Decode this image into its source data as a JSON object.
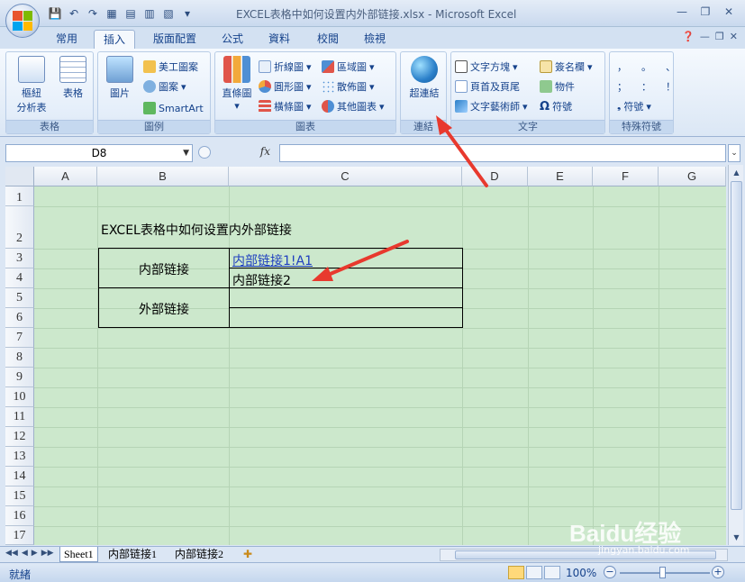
{
  "window": {
    "title": "EXCEL表格中如何设置内外部链接.xlsx - Microsoft Excel",
    "minimize": "—",
    "restore": "❐",
    "close": "✕"
  },
  "tabs": [
    {
      "label": "常用"
    },
    {
      "label": "插入",
      "active": true
    },
    {
      "label": "版面配置"
    },
    {
      "label": "公式"
    },
    {
      "label": "資料"
    },
    {
      "label": "校閱"
    },
    {
      "label": "檢視"
    }
  ],
  "ribbon": {
    "groups": {
      "tables": "表格",
      "illustrations": "圖例",
      "charts": "圖表",
      "links": "連結",
      "text": "文字",
      "symbols": "特殊符號"
    },
    "buttons": {
      "pivot_table_line1": "樞紐",
      "pivot_table_line2": "分析表",
      "table": "表格",
      "picture": "圖片",
      "clip_art": "美工圖案",
      "shapes": "圖案",
      "smartart": "SmartArt",
      "column_chart": "直條圖",
      "line_chart": "折線圖",
      "pie_chart": "圓形圖",
      "bar_chart": "橫條圖",
      "area_chart": "區域圖",
      "scatter_chart": "散佈圖",
      "other_charts": "其他圖表",
      "hyperlink": "超連結",
      "text_box": "文字方塊",
      "header_footer": "頁首及頁尾",
      "wordart": "文字藝術師",
      "signature_line": "簽名欄",
      "object": "物件",
      "symbol": "符號",
      "special_symbol": "符號"
    },
    "symbol_glyphs": [
      "，",
      "。",
      "、",
      "；",
      "：",
      "！"
    ]
  },
  "formula_bar": {
    "name_box": "D8",
    "fx": "fx",
    "value": ""
  },
  "columns": [
    "A",
    "B",
    "C",
    "D",
    "E",
    "F",
    "G"
  ],
  "rows": [
    "1",
    "2",
    "3",
    "4",
    "5",
    "6",
    "7",
    "8",
    "9",
    "10",
    "11",
    "12",
    "13",
    "14",
    "15",
    "16",
    "17"
  ],
  "cells": {
    "B2": "EXCEL表格中如何设置内外部链接",
    "B3": "内部链接",
    "C3": "内部链接1!A1",
    "C4": "内部链接2",
    "B5": "外部链接"
  },
  "sheets": [
    {
      "label": "Sheet1",
      "active": true
    },
    {
      "label": "内部链接1"
    },
    {
      "label": "内部链接2"
    }
  ],
  "status": {
    "mode": "就緒",
    "zoom": "100%"
  },
  "watermark": {
    "brand": "Baidu经验",
    "url": "jingyan.baidu.com"
  },
  "colors": {
    "sheet_background": "#cce8cc",
    "link": "#1f3fbf",
    "annotation_arrow": "#e8392e"
  }
}
